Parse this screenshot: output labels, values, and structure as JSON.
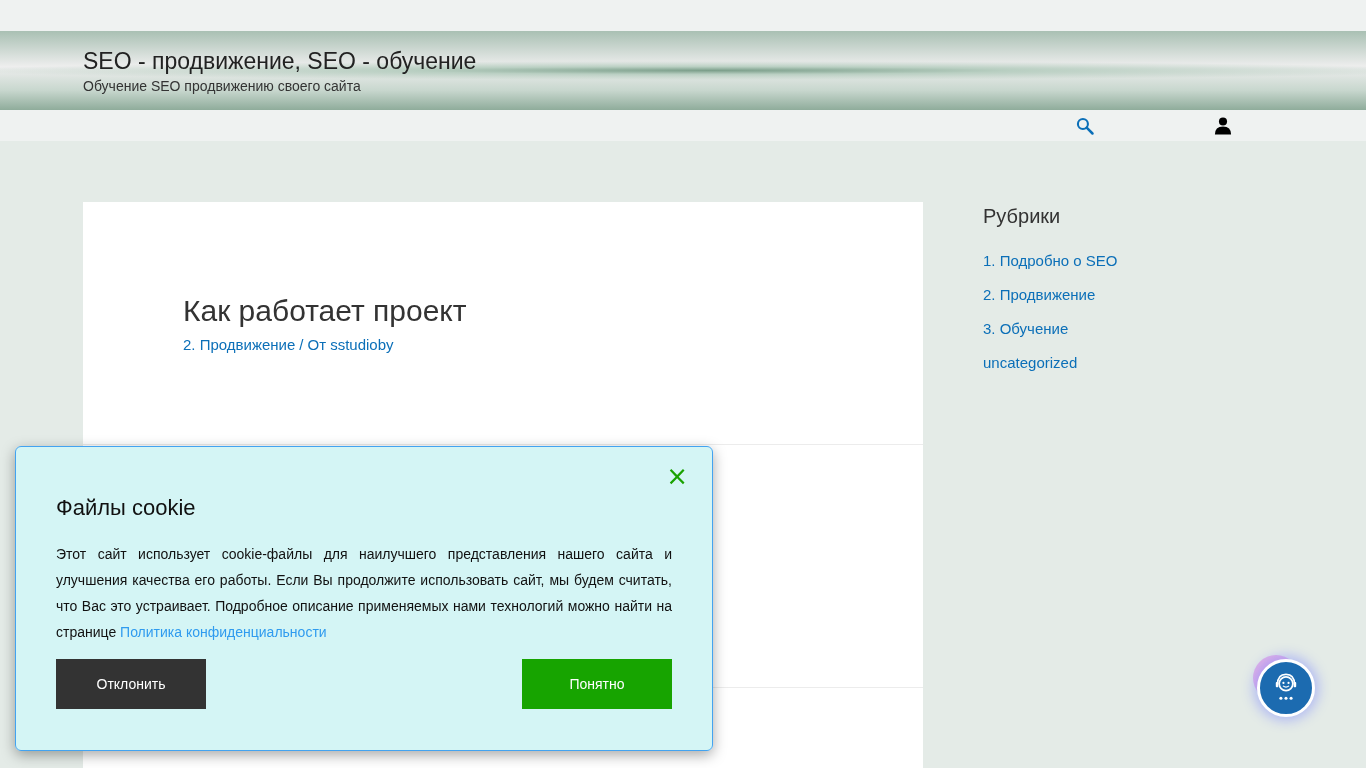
{
  "site": {
    "title": "SEO - продвижение, SEO - обучение",
    "tagline": "Обучение SEO продвижению своего сайта"
  },
  "article": {
    "title": "Как работает проект",
    "category": "2. Продвижение",
    "separator": "/",
    "author": "От sstudioby"
  },
  "sidebar": {
    "heading": "Рубрики",
    "items": [
      "1. Подробно о SEO",
      "2. Продвижение",
      "3. Обучение",
      "uncategorized"
    ]
  },
  "cookie_banner": {
    "close": "×",
    "title": "Файлы cookie",
    "text": "Этот сайт использует cookie-файлы для наилучшего представления нашего сайта и улучшения качества его работы. Если Вы продолжите использовать сайт, мы будем считать, что Вас это устраивает. Подробное описание применяемых нами технологий можно найти на странице",
    "link": "Политика конфиденциальности",
    "buttons": [
      {
        "label": "Отклонить",
        "kind": "decline"
      },
      {
        "label": "Понятно",
        "kind": "accept"
      }
    ]
  }
}
